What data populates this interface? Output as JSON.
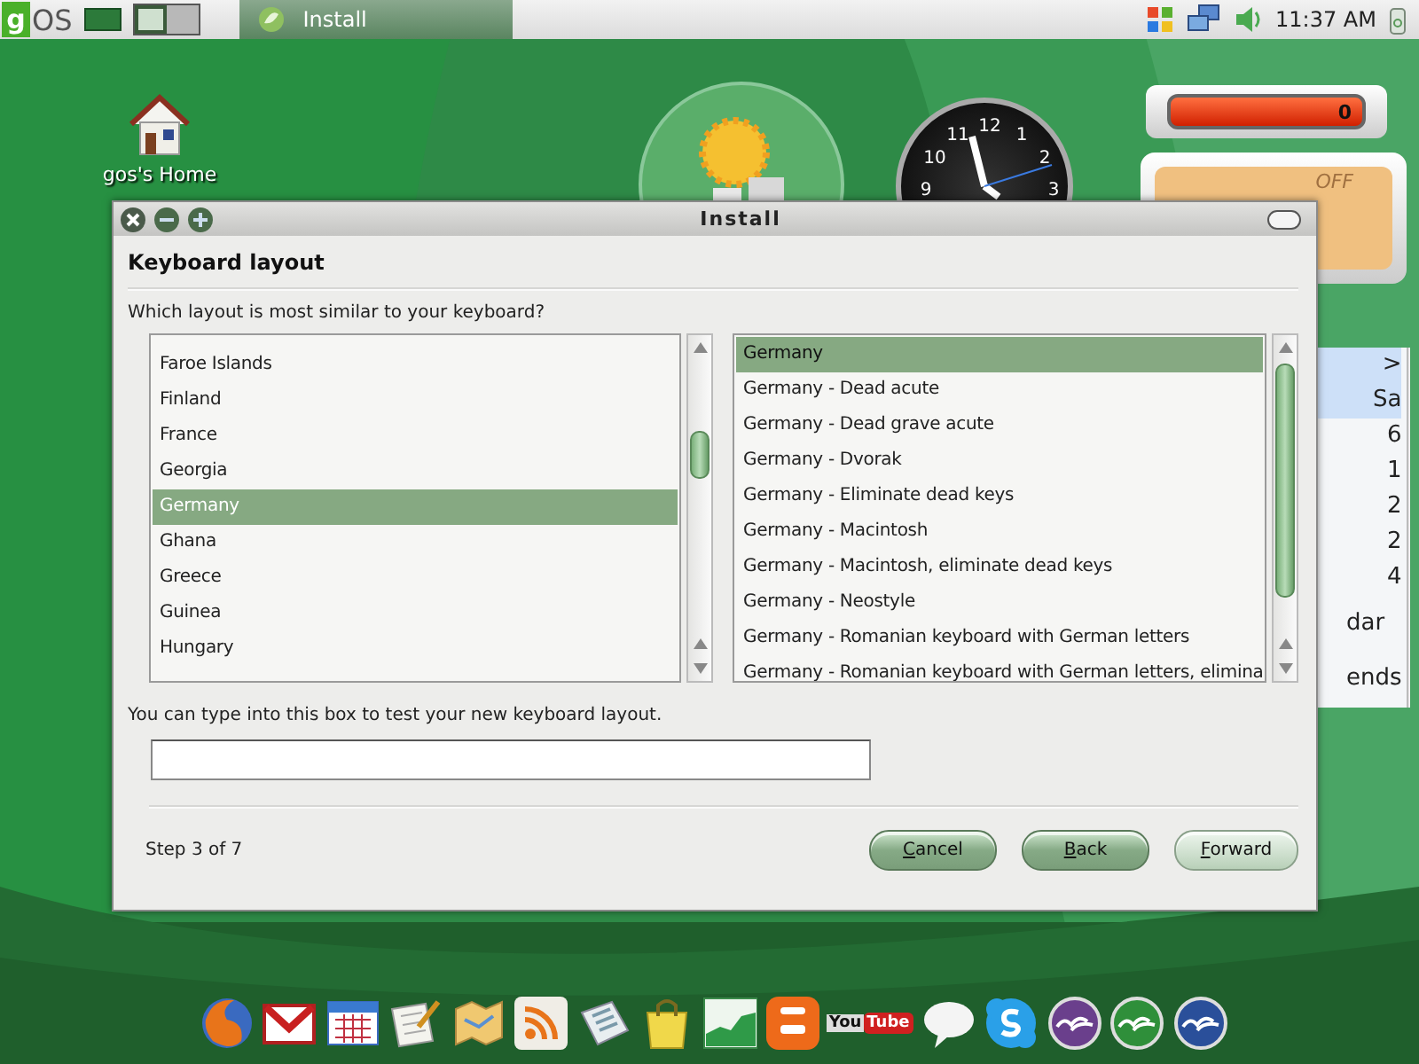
{
  "top_bar": {
    "logo_mark": "g",
    "logo_text": "OS",
    "tasks": [
      {
        "label": "Install",
        "selected": true
      }
    ],
    "clock": "11:37 AM"
  },
  "desktop_icons": [
    {
      "label": "gos's Home"
    }
  ],
  "clock_widget": {
    "numerals": [
      {
        "text": "12"
      },
      {
        "text": "1"
      },
      {
        "text": "2"
      },
      {
        "text": "3"
      },
      {
        "text": "9"
      },
      {
        "text": "10"
      },
      {
        "text": "11"
      }
    ]
  },
  "meter_widget": {
    "reading": "0"
  },
  "switch_widget": {
    "label": "OFF",
    "on": false
  },
  "calendar_widget": {
    "lines": [
      {
        "text": ">",
        "highlight": true
      },
      {
        "text": "Sa",
        "highlight": true
      },
      {
        "text": "6",
        "highlight": false
      },
      {
        "text": "1",
        "highlight": false
      },
      {
        "text": "2",
        "highlight": false
      },
      {
        "text": "2",
        "highlight": false
      },
      {
        "text": "4",
        "highlight": false
      },
      {
        "text": "dar",
        "highlight": false
      },
      {
        "text": "ends",
        "highlight": false
      }
    ]
  },
  "dialog": {
    "title": "Install",
    "heading": "Keyboard layout",
    "question": "Which layout is most similar to your keyboard?",
    "countries": [
      {
        "label": "Faroe Islands",
        "selected": false
      },
      {
        "label": "Finland",
        "selected": false
      },
      {
        "label": "France",
        "selected": false
      },
      {
        "label": "Georgia",
        "selected": false
      },
      {
        "label": "Germany",
        "selected": true
      },
      {
        "label": "Ghana",
        "selected": false
      },
      {
        "label": "Greece",
        "selected": false
      },
      {
        "label": "Guinea",
        "selected": false
      },
      {
        "label": "Hungary",
        "selected": false
      }
    ],
    "variants": [
      {
        "label": "Germany",
        "selected": true
      },
      {
        "label": "Germany - Dead acute",
        "selected": false
      },
      {
        "label": "Germany - Dead grave acute",
        "selected": false
      },
      {
        "label": "Germany - Dvorak",
        "selected": false
      },
      {
        "label": "Germany - Eliminate dead keys",
        "selected": false
      },
      {
        "label": "Germany - Macintosh",
        "selected": false
      },
      {
        "label": "Germany - Macintosh, eliminate dead keys",
        "selected": false
      },
      {
        "label": "Germany - Neostyle",
        "selected": false
      },
      {
        "label": "Germany - Romanian keyboard with German letters",
        "selected": false
      },
      {
        "label": "Germany - Romanian keyboard with German letters, elimina",
        "selected": false
      }
    ],
    "test_label": "You can type into this box to test your new keyboard layout.",
    "step": "Step 3 of 7",
    "buttons": [
      {
        "label": "Cancel",
        "kind": "strong"
      },
      {
        "label": "Back",
        "kind": "strong"
      },
      {
        "label": "Forward",
        "kind": "light"
      }
    ]
  },
  "dock": [
    {
      "kind": "browser"
    },
    {
      "kind": "mail"
    },
    {
      "kind": "calendar"
    },
    {
      "kind": "tasks"
    },
    {
      "kind": "map"
    },
    {
      "kind": "feed"
    },
    {
      "kind": "news"
    },
    {
      "kind": "bag"
    },
    {
      "kind": "chart"
    },
    {
      "kind": "blog"
    },
    {
      "kind": "video",
      "prefix": "You",
      "label": "Tube"
    },
    {
      "kind": "chat"
    },
    {
      "kind": "phone"
    },
    {
      "kind": "bird",
      "color": "#6a3f8c"
    },
    {
      "kind": "bird",
      "color": "#2f8f3a"
    },
    {
      "kind": "bird",
      "color": "#2a4f9a"
    }
  ]
}
